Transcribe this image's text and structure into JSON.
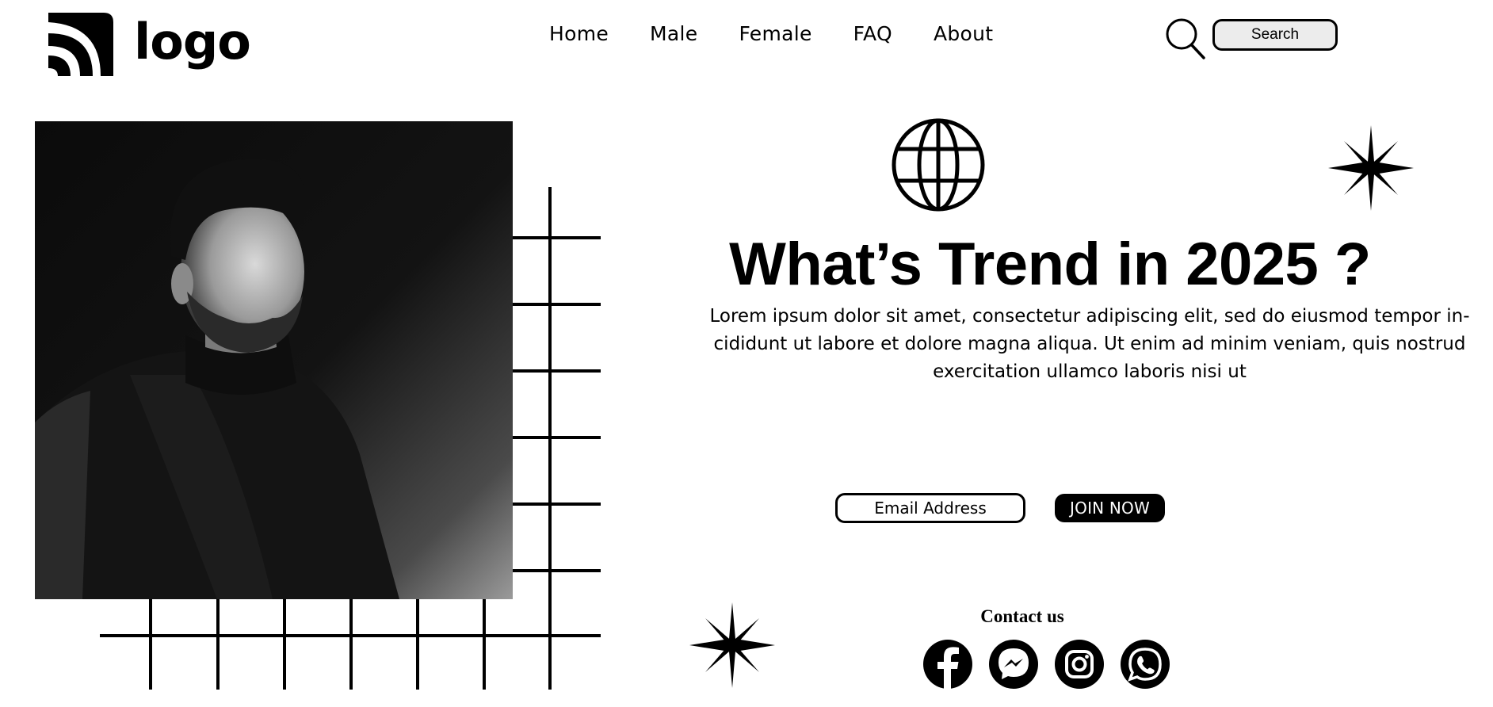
{
  "header": {
    "logo_text": "logo",
    "nav": [
      "Home",
      "Male",
      "Female",
      "FAQ",
      "About"
    ],
    "search_label": "Search"
  },
  "hero": {
    "headline": "What’s Trend in 2025 ?",
    "body": "Lorem ipsum dolor sit amet, consectetur adipiscing elit, sed do eiusmod tempor in- cididunt ut labore et dolore magna aliqua. Ut enim ad minim veniam, quis nostrud exercitation ullamco laboris nisi ut",
    "email_placeholder": "Email Address",
    "join_label": "JOIN NOW"
  },
  "contact": {
    "label": "Contact us",
    "icons": [
      "facebook-icon",
      "messenger-icon",
      "instagram-icon",
      "whatsapp-icon"
    ]
  },
  "colors": {
    "primary": "#000000",
    "background": "#ffffff",
    "search_fill": "#ececec"
  }
}
